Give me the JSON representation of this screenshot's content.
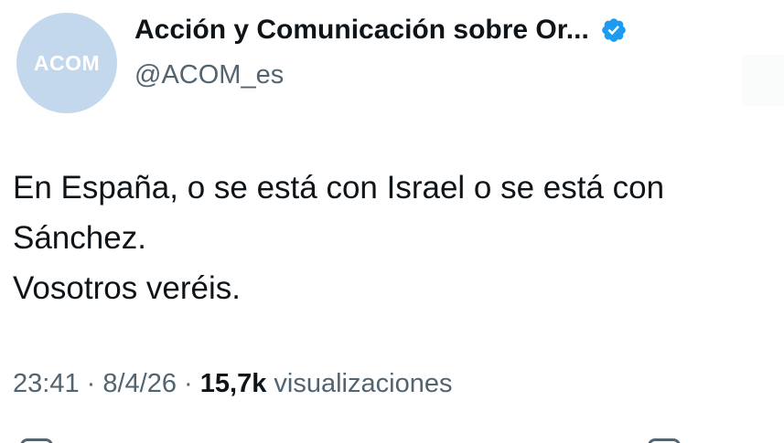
{
  "account": {
    "avatar_text": "ACOM",
    "display_name": "Acción y Comunicación sobre Or...",
    "handle": "@ACOM_es",
    "verified": true
  },
  "tweet": {
    "lines": [
      "En España, o se está con Israel o se está con",
      "Sánchez.",
      "Vosotros veréis."
    ]
  },
  "meta": {
    "time": "23:41",
    "separator": " · ",
    "date": "8/4/26",
    "views_count": "15,7k",
    "views_label": " visualizaciones"
  },
  "colors": {
    "avatar_bg": "#c3d8ec",
    "verified_blue": "#1d9bf0",
    "text_primary": "#0f1419",
    "text_secondary": "#536471"
  },
  "icons": [
    "verified-badge-icon",
    "reply-icon",
    "bookmark-icon"
  ]
}
